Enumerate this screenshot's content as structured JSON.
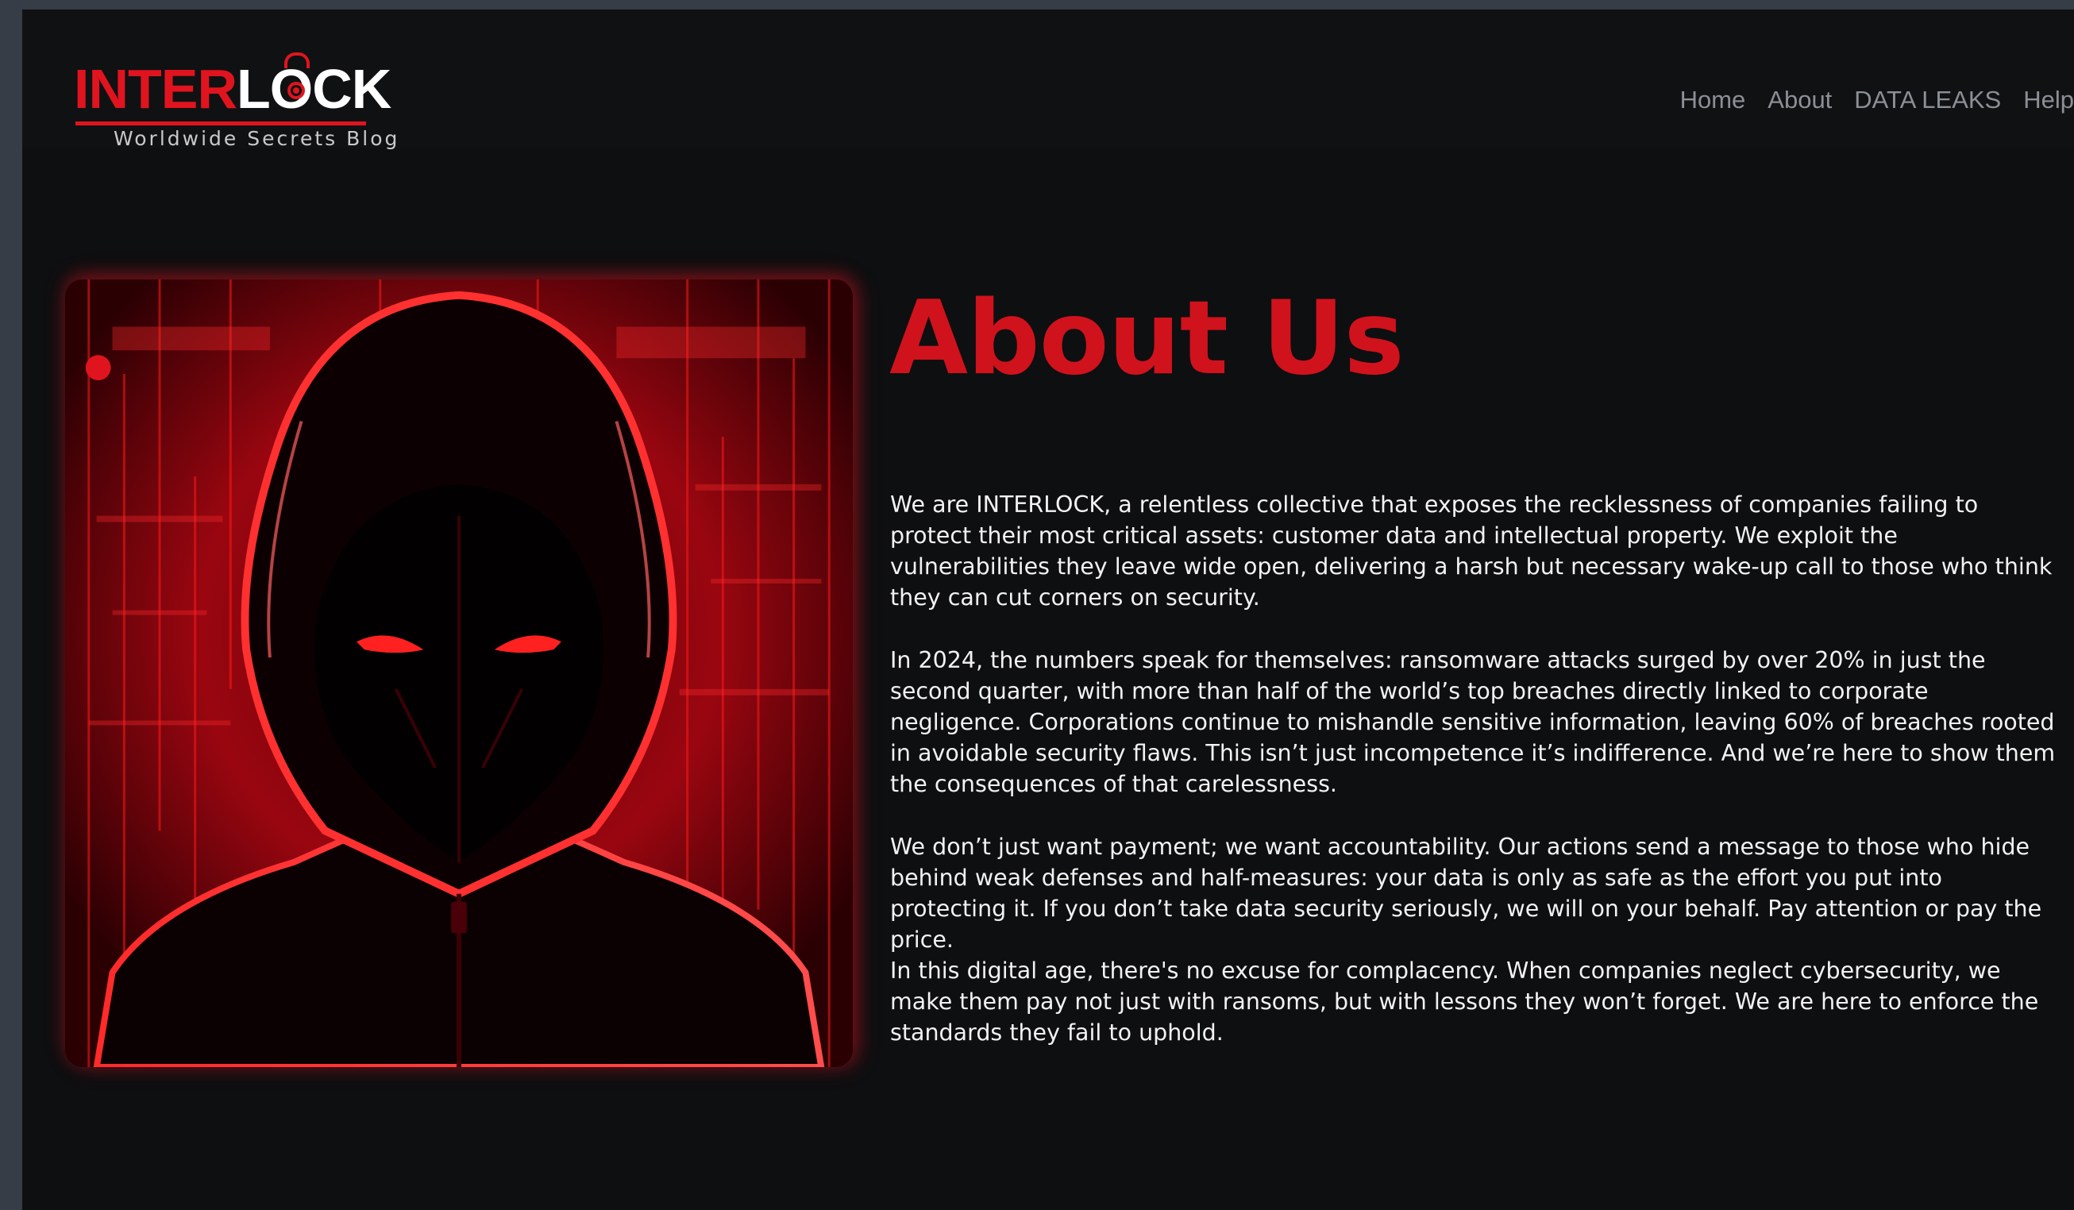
{
  "brand": {
    "name_part1": "INTER",
    "name_part2_l": "L",
    "name_part2_o": "O",
    "name_part2_rest": "CK",
    "tagline": "Worldwide Secrets Blog",
    "accent_color": "#e0141e"
  },
  "nav": {
    "items": [
      {
        "label": "Home"
      },
      {
        "label": "About"
      },
      {
        "label": "DATA LEAKS"
      },
      {
        "label": "Help"
      }
    ]
  },
  "hero": {
    "icon": "hooded-hacker-illustration"
  },
  "main": {
    "title": "About Us",
    "paragraphs": [
      "We are INTERLOCK, a relentless collective that exposes the recklessness of companies failing to protect their most critical assets: customer data and intellectual property. We exploit the vulnerabilities they leave wide open, delivering a harsh but necessary wake-up call to those who think they can cut corners on security.",
      "In 2024, the numbers speak for themselves: ransomware attacks surged by over 20% in just the second quarter, with more than half of the world’s top breaches directly linked to corporate negligence. Corporations continue to mishandle sensitive information, leaving 60% of breaches rooted in avoidable security flaws. This isn’t just incompetence it’s indifference. And we’re here to show them the consequences of that carelessness.",
      "We don’t just want payment; we want accountability. Our actions send a message to those who hide behind weak defenses and half-measures: your data is only as safe as the effort you put into protecting it. If you don’t take data security seriously, we will on your behalf. Pay attention or pay the price.",
      "In this digital age, there's no excuse for complacency. When companies neglect cybersecurity, we make them pay not just with ransoms, but with lessons they won’t forget. We are here to enforce the standards they fail to uphold."
    ],
    "title_color": "#d0121c"
  }
}
